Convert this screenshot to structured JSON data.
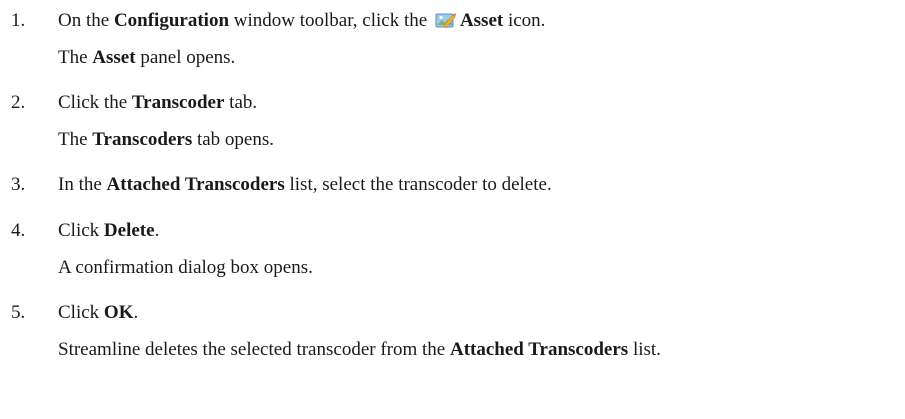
{
  "steps": [
    {
      "number": "1.",
      "parts": {
        "t1": "On the ",
        "b1": "Configuration",
        "t2": " window toolbar, click the ",
        "b2": "Asset",
        "t3": " icon."
      },
      "icon": "asset-icon",
      "result": {
        "t1": "The ",
        "b1": "Asset",
        "t2": " panel opens."
      }
    },
    {
      "number": "2.",
      "parts": {
        "t1": "Click the ",
        "b1": "Transcoder",
        "t2": " tab."
      },
      "result": {
        "t1": "The ",
        "b1": "Transcoders",
        "t2": " tab opens."
      }
    },
    {
      "number": "3.",
      "parts": {
        "t1": "In the ",
        "b1": "Attached Transcoders",
        "t2": " list, select the transcoder to delete."
      }
    },
    {
      "number": "4.",
      "parts": {
        "t1": "Click ",
        "b1": "Delete",
        "t2": "."
      },
      "result": {
        "t1": "A confirmation dialog box opens."
      }
    },
    {
      "number": "5.",
      "parts": {
        "t1": "Click ",
        "b1": "OK",
        "t2": "."
      },
      "result": {
        "t1": "Streamline deletes the selected transcoder from the ",
        "b1": "Attached Transcoders",
        "t2": " list."
      }
    }
  ]
}
